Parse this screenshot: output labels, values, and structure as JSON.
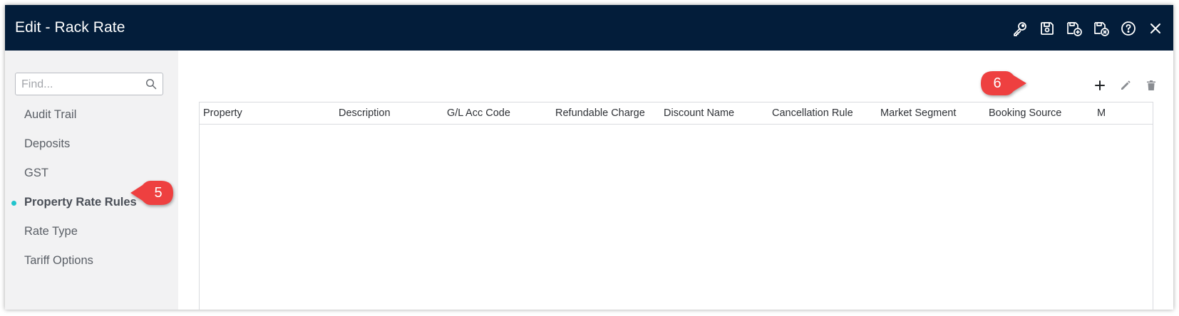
{
  "window": {
    "title": "Edit - Rack Rate",
    "title_icons": [
      "key-icon",
      "save-icon",
      "save-and-new-icon",
      "save-and-close-icon",
      "help-icon",
      "close-icon"
    ]
  },
  "sidebar": {
    "search": {
      "placeholder": "Find...",
      "value": ""
    },
    "items": [
      {
        "label": "Audit Trail",
        "active": false
      },
      {
        "label": "Deposits",
        "active": false
      },
      {
        "label": "GST",
        "active": false
      },
      {
        "label": "Property Rate Rules",
        "active": true
      },
      {
        "label": "Rate Type",
        "active": false
      },
      {
        "label": "Tariff Options",
        "active": false
      }
    ]
  },
  "toolbar": {
    "actions": [
      "add-icon",
      "edit-icon",
      "delete-icon"
    ]
  },
  "grid": {
    "columns": [
      "Property",
      "Description",
      "G/L Acc Code",
      "Refundable Charge",
      "Discount Name",
      "Cancellation Rule",
      "Market Segment",
      "Booking Source",
      "M"
    ],
    "rows": []
  },
  "callouts": {
    "step5": "5",
    "step6": "6"
  },
  "colors": {
    "titlebar": "#031d3a",
    "sidebar_bg": "#f2f2f3",
    "active_dot": "#20c4cc",
    "callout": "#ee4040"
  }
}
